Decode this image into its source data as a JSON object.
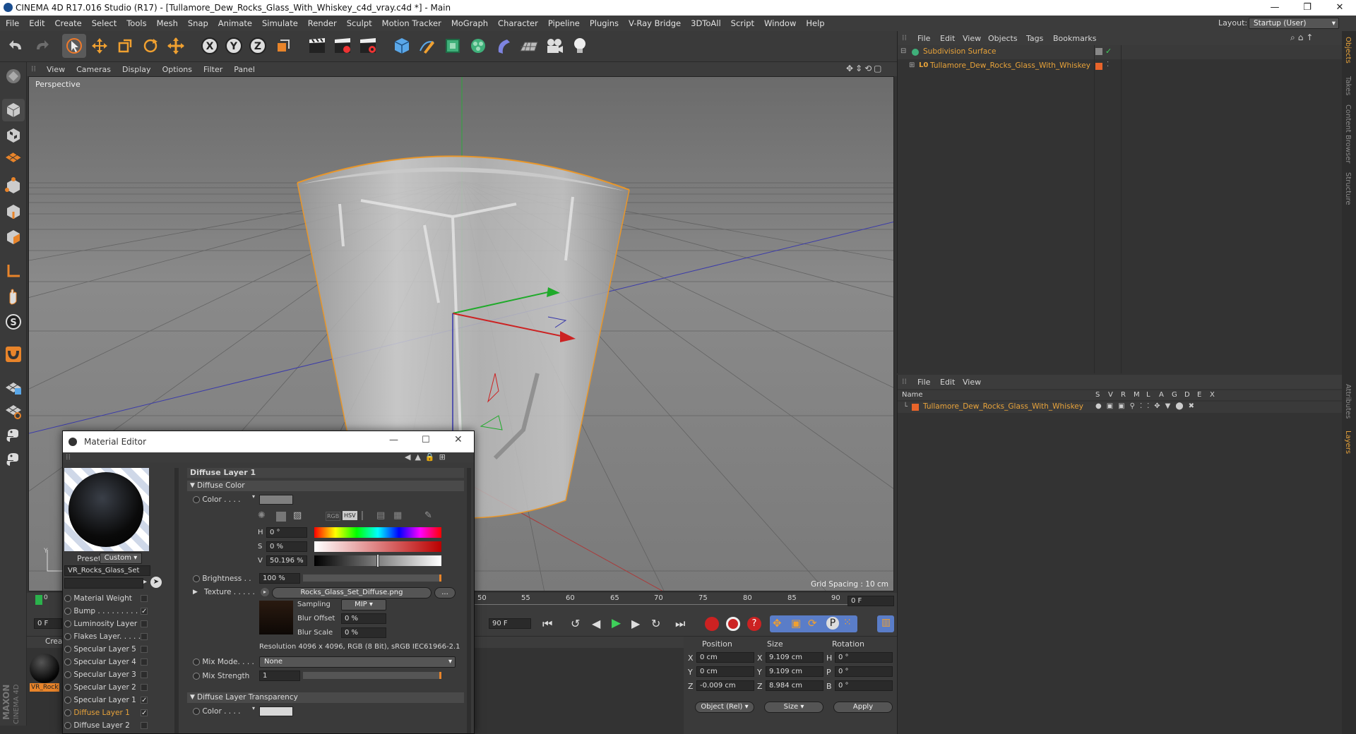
{
  "window": {
    "title": "CINEMA 4D R17.016 Studio (R17) - [Tullamore_Dew_Rocks_Glass_With_Whiskey_c4d_vray.c4d *] - Main",
    "minimize": "—",
    "maximize": "❐",
    "close": "✕"
  },
  "menu": [
    "File",
    "Edit",
    "Create",
    "Select",
    "Tools",
    "Mesh",
    "Snap",
    "Animate",
    "Simulate",
    "Render",
    "Sculpt",
    "Motion Tracker",
    "MoGraph",
    "Character",
    "Pipeline",
    "Plugins",
    "V-Ray Bridge",
    "3DToAll",
    "Script",
    "Window",
    "Help"
  ],
  "layout": {
    "label": "Layout:",
    "value": "Startup (User)"
  },
  "viewport": {
    "menu": [
      "View",
      "Cameras",
      "Display",
      "Options",
      "Filter",
      "Panel"
    ],
    "name": "Perspective",
    "grid_spacing": "Grid Spacing : 10 cm"
  },
  "timeline": {
    "ticks": [
      "50",
      "55",
      "60",
      "65",
      "70",
      "75",
      "80",
      "85",
      "90"
    ],
    "start_marker": "0",
    "current_frame": "0 F"
  },
  "anim": {
    "start_frame": "0 F",
    "end_frame": "90 F"
  },
  "material_manager": {
    "tab": "Crea",
    "material_name": "VR_Rock"
  },
  "brand": {
    "line1": "MAXON",
    "line2": "CINEMA 4D"
  },
  "coords": {
    "headers": {
      "position": "Position",
      "size": "Size",
      "rotation": "Rotation"
    },
    "rows": [
      {
        "axis": "X",
        "pos": "0 cm",
        "saxis": "X",
        "size": "9.109 cm",
        "raxis": "H",
        "rot": "0 °"
      },
      {
        "axis": "Y",
        "pos": "0 cm",
        "saxis": "Y",
        "size": "9.109 cm",
        "raxis": "P",
        "rot": "0 °"
      },
      {
        "axis": "Z",
        "pos": "-0.009 cm",
        "saxis": "Z",
        "size": "8.984 cm",
        "raxis": "B",
        "rot": "0 °"
      }
    ],
    "mode": "Object (Rel)",
    "size_mode": "Size",
    "apply": "Apply"
  },
  "objects": {
    "menu": [
      "File",
      "Edit",
      "View",
      "Objects",
      "Tags",
      "Bookmarks"
    ],
    "items": [
      {
        "name": "Subdivision Surface",
        "color": "#e8a33a"
      },
      {
        "name": "Tullamore_Dew_Rocks_Glass_With_Whiskey",
        "color": "#e8a33a"
      }
    ]
  },
  "layers": {
    "menu": [
      "File",
      "Edit",
      "View"
    ],
    "header": {
      "name": "Name",
      "cols": [
        "S",
        "V",
        "R",
        "M",
        "L",
        "A",
        "G",
        "D",
        "E",
        "X"
      ]
    },
    "items": [
      {
        "name": "Tullamore_Dew_Rocks_Glass_With_Whiskey",
        "color": "#e8642a"
      }
    ]
  },
  "right_tabs": [
    "Objects",
    "Takes",
    "Content Browser",
    "Structure",
    "Attributes",
    "Layers"
  ],
  "material_editor": {
    "title": "Material Editor",
    "preset_label": "Preset",
    "preset_value": "Custom",
    "material_name": "VR_Rocks_Glass_Set",
    "channels": [
      {
        "label": "Material Weight",
        "checked": false,
        "active": false
      },
      {
        "label": "Bump . . . . . . . . .",
        "checked": true,
        "active": false
      },
      {
        "label": "Luminosity Layer",
        "checked": false,
        "active": false
      },
      {
        "label": "Flakes Layer. . . . .",
        "checked": false,
        "active": false
      },
      {
        "label": "Specular Layer 5",
        "checked": false,
        "active": false
      },
      {
        "label": "Specular Layer 4",
        "checked": false,
        "active": false
      },
      {
        "label": "Specular Layer 3",
        "checked": false,
        "active": false
      },
      {
        "label": "Specular Layer 2",
        "checked": false,
        "active": false
      },
      {
        "label": "Specular Layer 1",
        "checked": true,
        "active": false
      },
      {
        "label": "Diffuse Layer 1",
        "checked": true,
        "active": true
      },
      {
        "label": "Diffuse Layer 2",
        "checked": false,
        "active": false
      }
    ],
    "panel_title": "Diffuse Layer 1",
    "section1": "Diffuse Color",
    "color_label": "Color . . . .",
    "hsv": [
      {
        "label": "H",
        "value": "0 °"
      },
      {
        "label": "S",
        "value": "0 %"
      },
      {
        "label": "V",
        "value": "50.196 %"
      }
    ],
    "v_level": 0.502,
    "brightness_label": "Brightness . .",
    "brightness_value": "100 %",
    "texture_label": "Texture . . . . .",
    "texture_file": "Rocks_Glass_Set_Diffuse.png",
    "texture_more": "...",
    "sampling_label": "Sampling",
    "sampling_value": "MIP",
    "blur_offset_label": "Blur Offset",
    "blur_offset_value": "0 %",
    "blur_scale_label": "Blur Scale",
    "blur_scale_value": "0 %",
    "resolution": "Resolution 4096 x 4096, RGB (8 Bit), sRGB IEC61966-2.1",
    "mix_mode_label": "Mix Mode. . . .",
    "mix_mode_value": "None",
    "mix_strength_label": "Mix Strength",
    "mix_strength_value": "1",
    "section2": "Diffuse Layer Transparency",
    "color2_label": "Color . . . .",
    "hsv_tab": "HSV"
  }
}
